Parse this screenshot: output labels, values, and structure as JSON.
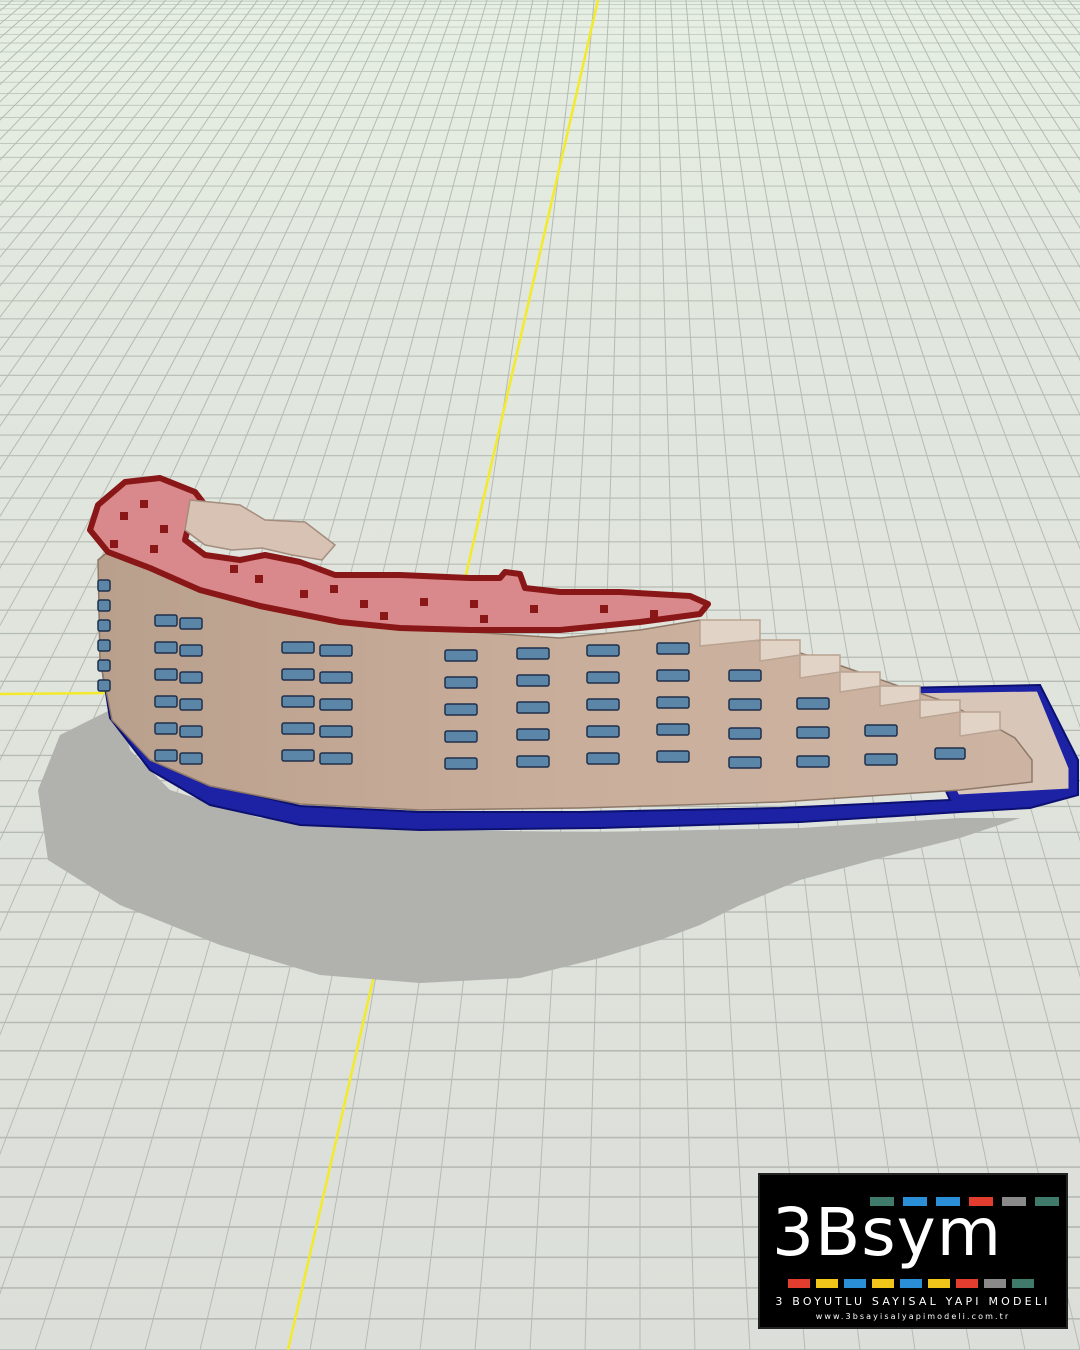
{
  "scene": {
    "description_free": true,
    "ground_color": "#dfe4dd",
    "grid_line_color": "#b5bbb4",
    "sky_color": "#e9f1e7",
    "axis_color": "#f2ea2a",
    "shadow_color": "#b0b1ac",
    "building": {
      "wall_color": "#c8ad9a",
      "roof_color": "#d9898b",
      "roof_edge_color": "#8a1717",
      "podium_color": "#1c22a3",
      "window_color": "#5c86a7",
      "terrace_color": "#e0cfc1"
    }
  },
  "logo": {
    "title": "3Bsym",
    "subtitle": "3 BOYUTLU SAYISAL YAPI MODELI",
    "url": "www.3bsayisalyapimodeli.com.tr",
    "top_bar_colors": [
      "#3f7a6a",
      "#2b8fd8",
      "#2b8fd8",
      "#e23d2e",
      "#8a8a8a",
      "#3f7a6a"
    ],
    "bottom_bar_colors": [
      "#e23d2e",
      "#f2c51b",
      "#2b8fd8",
      "#f2c51b",
      "#2b8fd8",
      "#f2c51b",
      "#e23d2e",
      "#8a8a8a",
      "#3f7a6a"
    ]
  }
}
